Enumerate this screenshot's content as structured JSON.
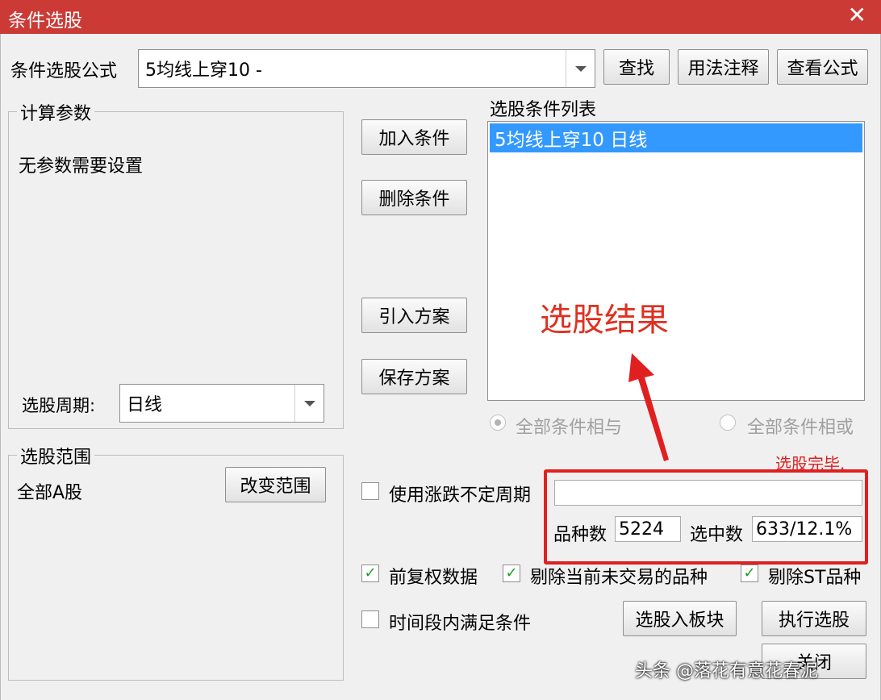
{
  "window": {
    "title": "条件选股",
    "close_glyph": "✕"
  },
  "formula": {
    "label": "条件选股公式",
    "value": "5均线上穿10  -"
  },
  "buttons": {
    "find": "查找",
    "usage": "用法注释",
    "view_formula": "查看公式",
    "add_condition": "加入条件",
    "delete_condition": "删除条件",
    "import_plan": "引入方案",
    "save_plan": "保存方案",
    "change_range": "改变范围",
    "to_block": "选股入板块",
    "execute": "执行选股",
    "close": "关闭"
  },
  "params": {
    "legend": "计算参数",
    "note": "无参数需要设置",
    "period_label": "选股周期:",
    "period_value": "日线"
  },
  "conditions": {
    "legend": "选股条件列表",
    "items": [
      "5均线上穿10  日线"
    ]
  },
  "logic": {
    "and_label": "全部条件相与",
    "or_label": "全部条件相或",
    "selected": "and"
  },
  "annotation": {
    "label": "选股结果",
    "color": "#e02020"
  },
  "range": {
    "legend": "选股范围",
    "value": "全部A股"
  },
  "status": {
    "text": "选股完毕.",
    "input_value": ""
  },
  "stats": {
    "count_label": "品种数",
    "count_value": "5224",
    "selected_label": "选中数",
    "selected_value": "633/12.1%"
  },
  "options": {
    "variable_period": {
      "label": "使用涨跌不定周期",
      "checked": false
    },
    "adjusted_data": {
      "label": "前复权数据",
      "checked": true
    },
    "exclude_untraded": {
      "label": "剔除当前未交易的品种",
      "checked": true
    },
    "exclude_st": {
      "label": "剔除ST品种",
      "checked": true
    },
    "time_range": {
      "label": "时间段内满足条件",
      "checked": false
    }
  },
  "watermark": "头条 @落花有意花春泥",
  "colors": {
    "titlebar": "#cc3a36",
    "selection": "#3399ff",
    "highlight_border": "#e02020",
    "check": "#1aa01a"
  }
}
